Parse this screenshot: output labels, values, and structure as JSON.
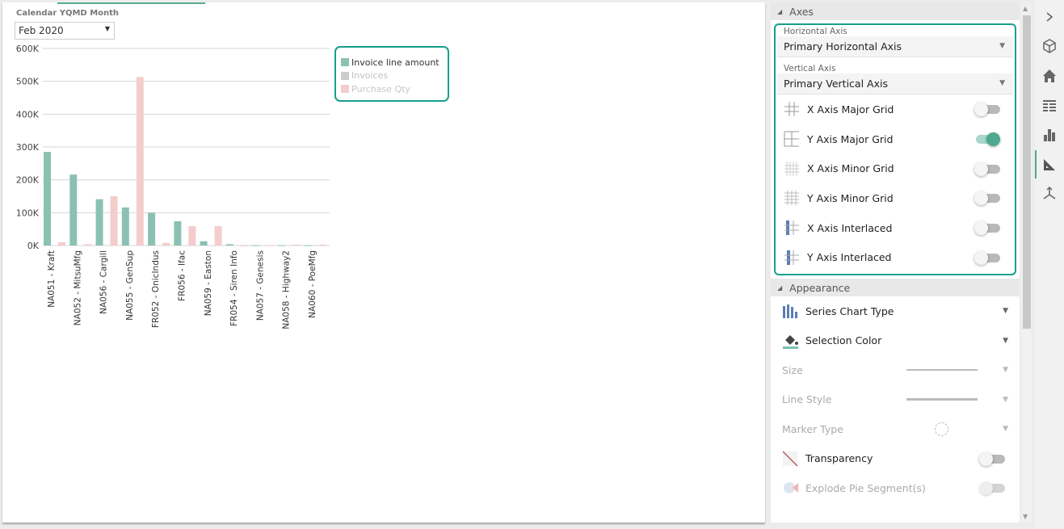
{
  "filter": {
    "label": "Calendar YQMD Month",
    "value": "Feb 2020"
  },
  "chart_data": {
    "type": "bar",
    "title": "",
    "xlabel": "",
    "ylabel": "",
    "ylim": [
      0,
      600000
    ],
    "yticks": [
      0,
      100000,
      200000,
      300000,
      400000,
      500000,
      600000
    ],
    "ytick_labels": [
      "0K",
      "100K",
      "200K",
      "300K",
      "400K",
      "500K",
      "600K"
    ],
    "grid": {
      "y_major": true,
      "x_major": false
    },
    "legend_position": "top-right",
    "categories": [
      "NA051 - Kraft",
      "NA052 - MitsuMfg",
      "NA056 - Cargill",
      "NA055 - GenSup",
      "FR052 - OnicIndus",
      "FR056 - Ifac",
      "NA059 - Easton",
      "FR054 - Siren Info",
      "NA057 - Genesis",
      "NA058 - Highway2",
      "NA060 - PoeMfg"
    ],
    "series": [
      {
        "name": "Invoice line amount",
        "color": "#8bc1b3",
        "visible": true,
        "values": [
          285000,
          216000,
          141000,
          116000,
          100000,
          74000,
          13000,
          4000,
          1000,
          1000,
          1000
        ]
      },
      {
        "name": "Invoices",
        "color": "#cccccc",
        "visible": false,
        "values": [
          0,
          0,
          0,
          0,
          0,
          0,
          0,
          0,
          0,
          0,
          0
        ]
      },
      {
        "name": "Purchase Qty",
        "color": "#f3cdcc",
        "visible": true,
        "values": [
          10000,
          4000,
          150000,
          513000,
          8000,
          59000,
          59000,
          0,
          500,
          3000,
          3000
        ]
      }
    ]
  },
  "legend": {
    "items": [
      {
        "label": "Invoice line amount",
        "color": "#8bc1b3",
        "text_color": "#333333"
      },
      {
        "label": "Invoices",
        "color": "#cccccc",
        "text_color": "#c0c0c0"
      },
      {
        "label": "Purchase Qty",
        "color": "#f3cdcc",
        "text_color": "#c8c8c8"
      }
    ]
  },
  "panel": {
    "axes": {
      "title": "Axes",
      "horizontal_label": "Horizontal Axis",
      "horizontal_value": "Primary Horizontal Axis",
      "vertical_label": "Vertical Axis",
      "vertical_value": "Primary Vertical Axis",
      "options": [
        {
          "label": "X Axis Major Grid",
          "icon": "x-major-grid-icon",
          "on": false
        },
        {
          "label": "Y Axis Major Grid",
          "icon": "y-major-grid-icon",
          "on": true
        },
        {
          "label": "X Axis Minor Grid",
          "icon": "x-minor-grid-icon",
          "on": false
        },
        {
          "label": "Y Axis Minor Grid",
          "icon": "y-minor-grid-icon",
          "on": false
        },
        {
          "label": "X Axis Interlaced",
          "icon": "x-interlaced-icon",
          "on": false
        },
        {
          "label": "Y Axis Interlaced",
          "icon": "y-interlaced-icon",
          "on": false
        }
      ]
    },
    "appearance": {
      "title": "Appearance",
      "series_chart_type": "Series Chart Type",
      "selection_color": "Selection Color",
      "size": "Size",
      "line_style": "Line Style",
      "marker_type": "Marker Type",
      "transparency": "Transparency",
      "explode_pie": "Explode Pie Segment(s)"
    }
  },
  "colors": {
    "accent": "#16a08a",
    "toggle_on": "#4fa890"
  }
}
